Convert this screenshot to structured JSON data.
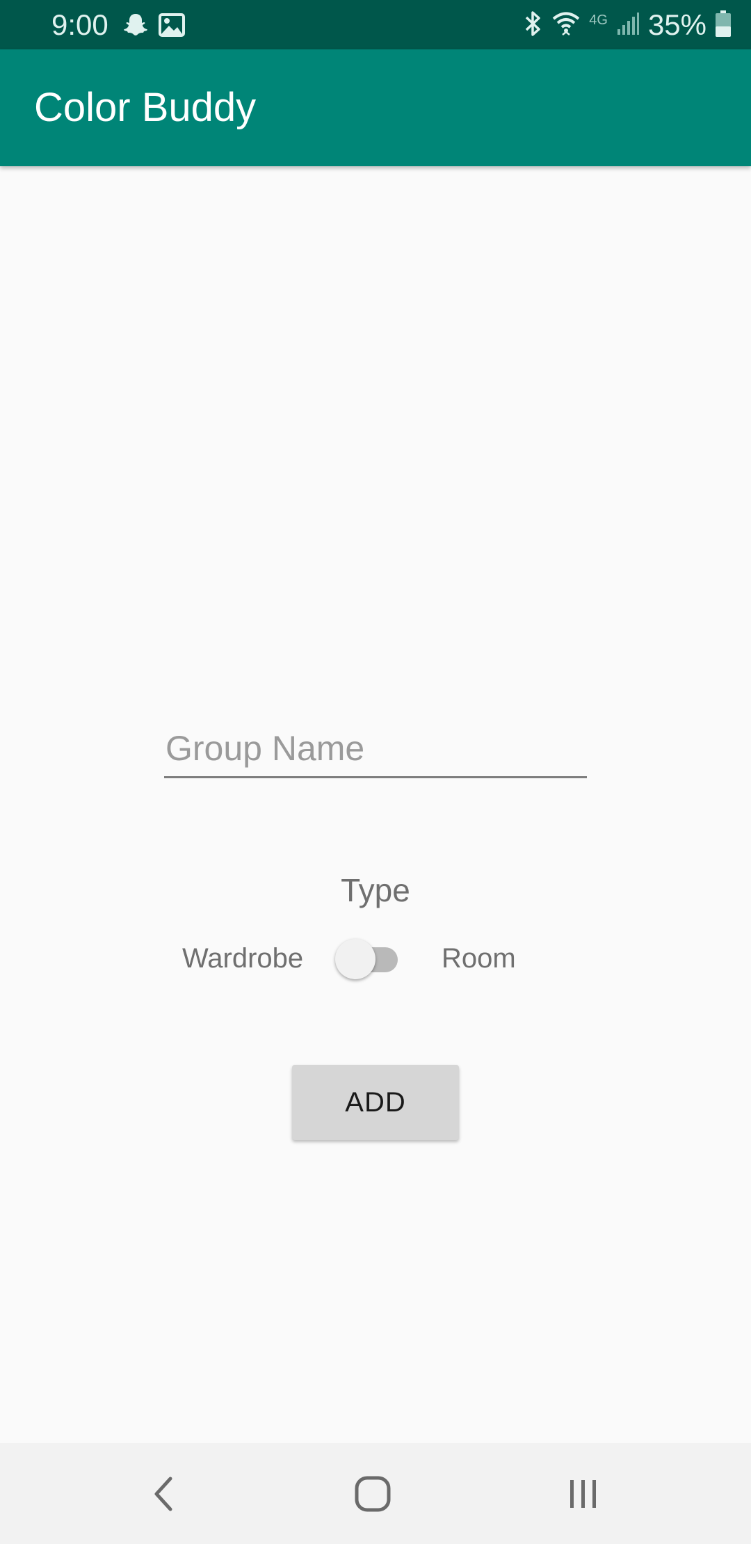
{
  "status_bar": {
    "time": "9:00",
    "battery_percent": "35%",
    "network_label": "4G",
    "icons": [
      "snapchat-icon",
      "image-icon",
      "bluetooth-icon",
      "wifi-icon",
      "signal-icon",
      "battery-icon"
    ]
  },
  "app_bar": {
    "title": "Color Buddy",
    "background_color": "#008577",
    "status_bar_color": "#00574b"
  },
  "form": {
    "group_name_value": "",
    "group_name_placeholder": "Group Name",
    "type_label": "Type",
    "toggle_left_label": "Wardrobe",
    "toggle_right_label": "Room",
    "toggle_checked": false,
    "add_button_label": "ADD"
  },
  "nav_bar": {
    "buttons": [
      "back-icon",
      "home-icon",
      "recent-apps-icon"
    ]
  }
}
